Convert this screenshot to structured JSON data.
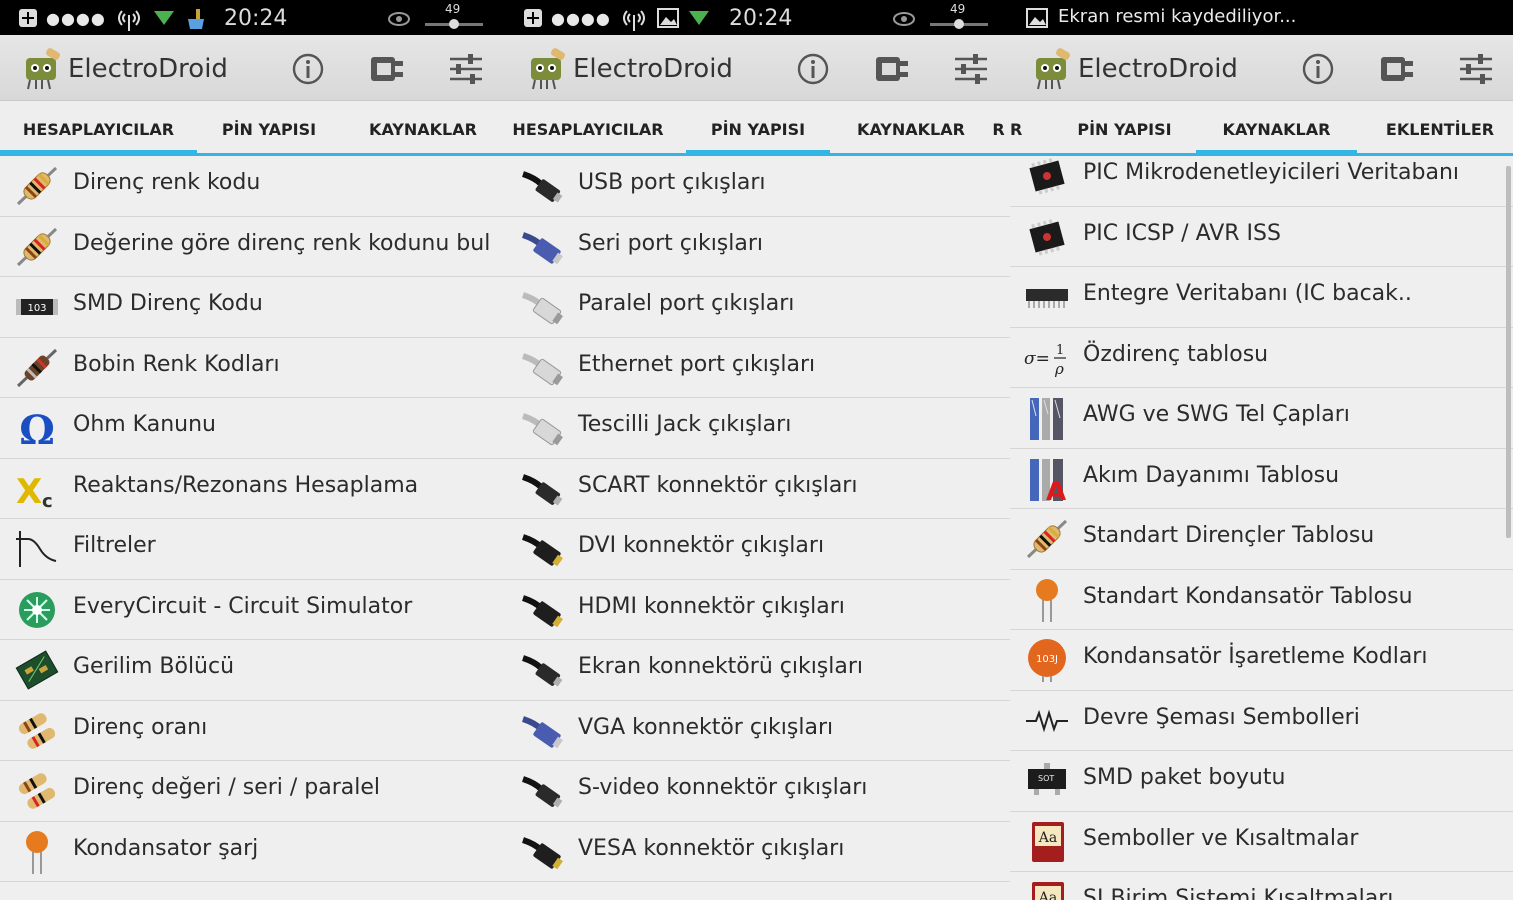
{
  "app": {
    "title": "ElectroDroid"
  },
  "status": {
    "time": "20:24",
    "volume": "49",
    "recording_msg": "Ekran resmi kaydediliyor..."
  },
  "tabs": {
    "calculators": "HESAPLAYICILAR",
    "pinouts": "PİN YAPISI",
    "resources": "KAYNAKLAR",
    "plugins": "EKLENTİLER",
    "partial_r": "R"
  },
  "panel1": {
    "items": [
      {
        "label": "Direnç renk kodu",
        "icon": "resistor-icon"
      },
      {
        "label": "Değerine göre direnç renk kodunu bul",
        "icon": "resistor-icon"
      },
      {
        "label": "SMD Direnç Kodu",
        "icon": "smd-resistor-icon"
      },
      {
        "label": "Bobin Renk Kodları",
        "icon": "inductor-icon"
      },
      {
        "label": "Ohm Kanunu",
        "icon": "omega-icon"
      },
      {
        "label": "Reaktans/Rezonans Hesaplama",
        "icon": "xc-icon"
      },
      {
        "label": "Filtreler",
        "icon": "filter-curve-icon"
      },
      {
        "label": "EveryCircuit - Circuit Simulator",
        "icon": "everycircuit-icon"
      },
      {
        "label": "Gerilim Bölücü",
        "icon": "pcb-icon"
      },
      {
        "label": "Direnç oranı",
        "icon": "resistors-icon"
      },
      {
        "label": "Direnç değeri / seri / paralel",
        "icon": "resistors-network-icon"
      },
      {
        "label": "Kondansator şarj",
        "icon": "capacitor-icon"
      }
    ]
  },
  "panel2": {
    "items": [
      {
        "label": "USB port çıkışları",
        "icon": "usb-cable-icon"
      },
      {
        "label": "Seri port çıkışları",
        "icon": "serial-cable-icon"
      },
      {
        "label": "Paralel port çıkışları",
        "icon": "parallel-cable-icon"
      },
      {
        "label": "Ethernet port çıkışları",
        "icon": "ethernet-cable-icon"
      },
      {
        "label": "Tescilli Jack çıkışları",
        "icon": "jack-cable-icon"
      },
      {
        "label": "SCART konnektör çıkışları",
        "icon": "scart-cable-icon"
      },
      {
        "label": "DVI konnektör çıkışları",
        "icon": "dvi-cable-icon"
      },
      {
        "label": "HDMI konnektör çıkışları",
        "icon": "hdmi-cable-icon"
      },
      {
        "label": "Ekran konnektörü çıkışları",
        "icon": "displayport-cable-icon"
      },
      {
        "label": "VGA konnektör çıkışları",
        "icon": "vga-cable-icon"
      },
      {
        "label": "S-video konnektör çıkışları",
        "icon": "svideo-cable-icon"
      },
      {
        "label": "VESA konnektör çıkışları",
        "icon": "vesa-cable-icon"
      }
    ]
  },
  "panel3": {
    "items": [
      {
        "label": "PIC Mikrodenetleyicileri Veritabanı",
        "icon": "chip-icon"
      },
      {
        "label": "PIC ICSP / AVR ISS",
        "icon": "chip-icon"
      },
      {
        "label": "Entegre Veritabanı (IC bacak..",
        "icon": "ic-dip-icon"
      },
      {
        "label": "Özdirenç tablosu",
        "icon": "resistivity-formula-icon"
      },
      {
        "label": "AWG ve SWG Tel Çapları",
        "icon": "wire-icon"
      },
      {
        "label": "Akım Dayanımı Tablosu",
        "icon": "wire-current-icon"
      },
      {
        "label": "Standart Dirençler Tablosu",
        "icon": "resistor-icon"
      },
      {
        "label": "Standart Kondansatör Tablosu",
        "icon": "capacitor-icon"
      },
      {
        "label": "Kondansatör İşaretleme Kodları",
        "icon": "capacitor-code-icon"
      },
      {
        "label": "Devre Şeması Sembolleri",
        "icon": "schematic-symbol-icon"
      },
      {
        "label": "SMD paket boyutu",
        "icon": "sot-package-icon"
      },
      {
        "label": "Semboller ve Kısaltmalar",
        "icon": "dictionary-icon"
      },
      {
        "label": "SI Birim Sistemi Kısaltmaları",
        "icon": "dictionary-icon"
      }
    ]
  },
  "colors": {
    "accent": "#33b5e5",
    "background": "#efefef",
    "statusbar": "#000000"
  }
}
